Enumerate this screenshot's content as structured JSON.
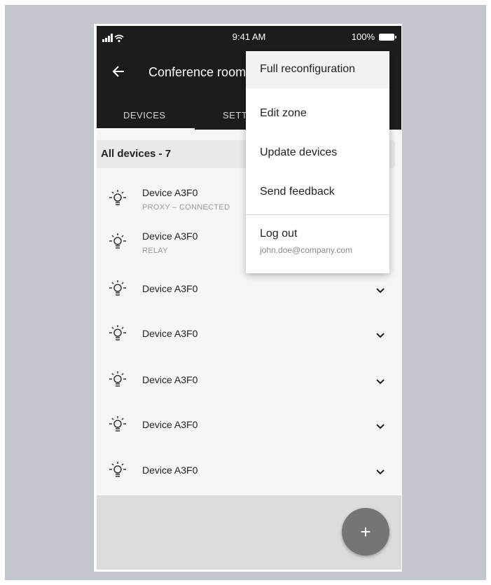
{
  "status_bar": {
    "time": "9:41 AM",
    "battery": "100%"
  },
  "header": {
    "title": "Conference room"
  },
  "tabs": [
    {
      "label": "DEVICES",
      "active": true
    },
    {
      "label": "SETTINGS",
      "active": false
    }
  ],
  "summary": {
    "label": "All devices - 7"
  },
  "devices": [
    {
      "name": "Device  A3F0",
      "subtitle": "PROXY – CONNECTED"
    },
    {
      "name": "Device  A3F0",
      "subtitle": "RELAY"
    },
    {
      "name": "Device  A3F0",
      "subtitle": ""
    },
    {
      "name": "Device  A3F0",
      "subtitle": ""
    },
    {
      "name": "Device  A3F0",
      "subtitle": ""
    },
    {
      "name": "Device  A3F0",
      "subtitle": ""
    },
    {
      "name": "Device  A3F0",
      "subtitle": ""
    }
  ],
  "menu": {
    "full_reconfiguration": "Full reconfiguration",
    "edit_zone": "Edit zone",
    "update_devices": "Update devices",
    "send_feedback": "Send feedback",
    "log_out": "Log out",
    "user_email": "john.doe@company.com"
  },
  "fab": {
    "label": "+"
  },
  "icons": {
    "back": "arrow-left-icon",
    "device": "lightbulb-icon",
    "expand": "chevron-down-icon",
    "signal": "cellular-signal-icon",
    "wifi": "wifi-icon",
    "battery": "battery-icon",
    "add": "plus-icon"
  },
  "colors": {
    "appbar": "#1c1c1c",
    "background": "#c3c7cd",
    "fab": "#757575",
    "menu_highlight": "#f2f2f2"
  }
}
